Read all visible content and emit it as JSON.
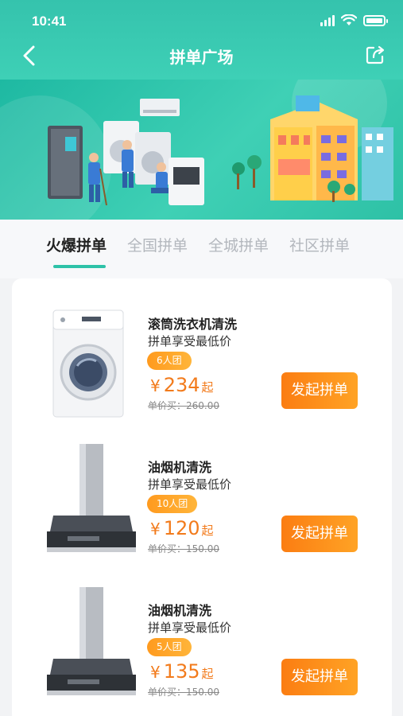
{
  "status_bar": {
    "time": "10:41"
  },
  "nav": {
    "title": "拼单广场",
    "back_icon": "chevron-left-icon",
    "share_icon": "share-icon"
  },
  "banner": {
    "image": "appliance-cleaning-illustration"
  },
  "tabs": [
    {
      "label": "火爆拼单",
      "active": true
    },
    {
      "label": "全国拼单",
      "active": false
    },
    {
      "label": "全城拼单",
      "active": false
    },
    {
      "label": "社区拼单",
      "active": false
    }
  ],
  "items": [
    {
      "name": "滚筒洗衣机清洗",
      "subtitle": "拼单享受最低价",
      "group": "6人团",
      "currency": "¥",
      "price": "234",
      "price_suffix": "起",
      "original_price": "单价买：260.00",
      "button": "发起拼单",
      "image": "washing-machine"
    },
    {
      "name": "油烟机清洗",
      "subtitle": "拼单享受最低价",
      "group": "10人团",
      "currency": "¥",
      "price": "120",
      "price_suffix": "起",
      "original_price": "单价买：150.00",
      "button": "发起拼单",
      "image": "range-hood"
    },
    {
      "name": "油烟机清洗",
      "subtitle": "拼单享受最低价",
      "group": "5人团",
      "currency": "¥",
      "price": "135",
      "price_suffix": "起",
      "original_price": "单价买：150.00",
      "button": "发起拼单",
      "image": "range-hood"
    }
  ],
  "colors": {
    "primary": "#35c3ad",
    "accent": "#f27b1c",
    "button": "#fb7d12"
  }
}
